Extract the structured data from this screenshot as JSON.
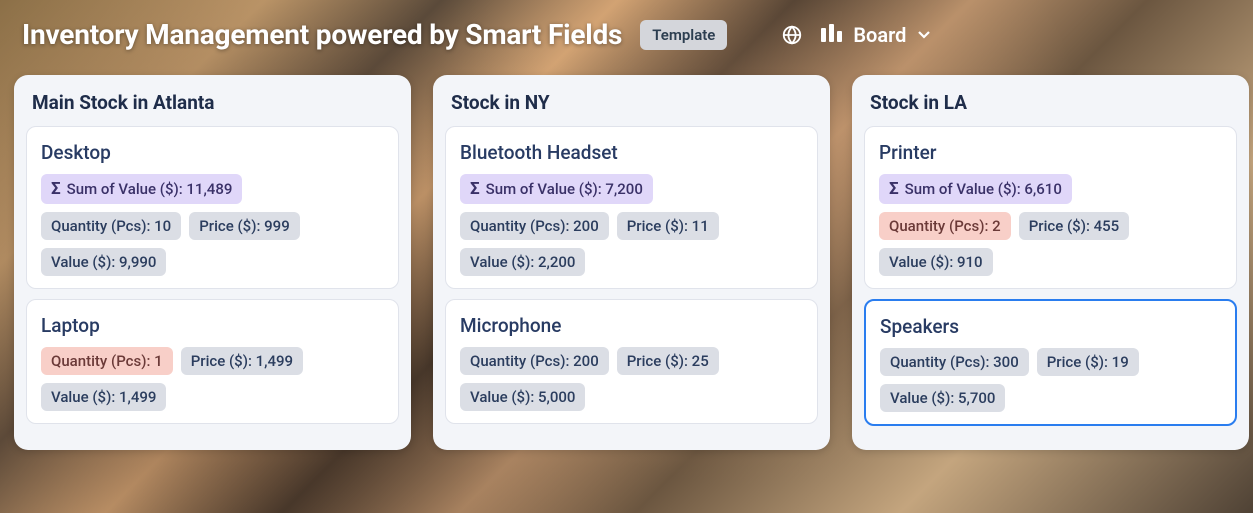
{
  "header": {
    "title": "Inventory Management powered by Smart Fields",
    "template_label": "Template",
    "view_label": "Board"
  },
  "labels": {
    "sum_prefix": "Sum of Value ($):",
    "qty_prefix": "Quantity (Pcs):",
    "price_prefix": "Price ($):",
    "value_prefix": "Value ($):"
  },
  "columns": [
    {
      "title": "Main Stock in Atlanta",
      "cards": [
        {
          "title": "Desktop",
          "selected": false,
          "sum": "11,489",
          "qty": "10",
          "qty_warn": false,
          "price": "999",
          "value": "9,990"
        },
        {
          "title": "Laptop",
          "selected": false,
          "sum": null,
          "qty": "1",
          "qty_warn": true,
          "price": "1,499",
          "value": "1,499"
        }
      ]
    },
    {
      "title": "Stock in NY",
      "cards": [
        {
          "title": "Bluetooth Headset",
          "selected": false,
          "sum": "7,200",
          "qty": "200",
          "qty_warn": false,
          "price": "11",
          "value": "2,200"
        },
        {
          "title": "Microphone",
          "selected": false,
          "sum": null,
          "qty": "200",
          "qty_warn": false,
          "price": "25",
          "value": "5,000"
        }
      ]
    },
    {
      "title": "Stock in LA",
      "cards": [
        {
          "title": "Printer",
          "selected": false,
          "sum": "6,610",
          "qty": "2",
          "qty_warn": true,
          "price": "455",
          "value": "910"
        },
        {
          "title": "Speakers",
          "selected": true,
          "sum": null,
          "qty": "300",
          "qty_warn": false,
          "price": "19",
          "value": "5,700"
        }
      ]
    }
  ]
}
